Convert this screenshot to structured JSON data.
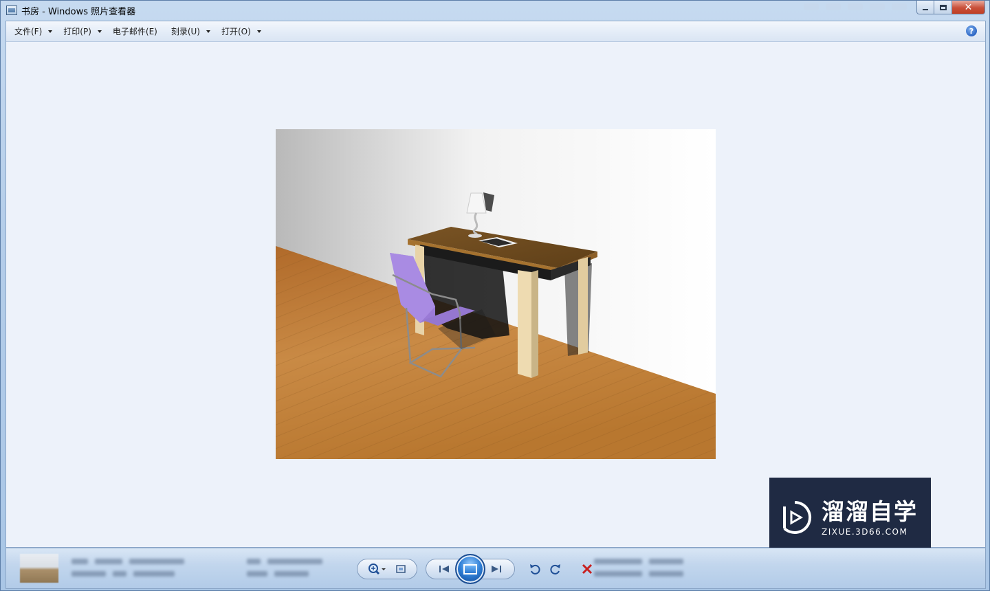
{
  "window": {
    "title": "书房 - Windows 照片查看器"
  },
  "menubar": {
    "items": [
      {
        "label": "文件(F)",
        "has_dropdown": true
      },
      {
        "label": "打印(P)",
        "has_dropdown": true
      },
      {
        "label": "电子邮件(E)",
        "has_dropdown": false
      },
      {
        "label": "刻录(U)",
        "has_dropdown": true
      },
      {
        "label": "打开(O)",
        "has_dropdown": true
      }
    ],
    "help_icon": "help-icon"
  },
  "controls": {
    "icons": [
      "zoom-icon",
      "fit-to-window-icon",
      "previous-icon",
      "slideshow-icon",
      "next-icon",
      "rotate-left-icon",
      "rotate-right-icon",
      "delete-icon"
    ]
  },
  "watermark": {
    "cn": "溜溜自学",
    "en": "ZIXUE.3D66.COM"
  },
  "colors": {
    "delete": "#c8201f",
    "accent": "#2f7fd6",
    "watermark_bg": "#1f2a43"
  }
}
